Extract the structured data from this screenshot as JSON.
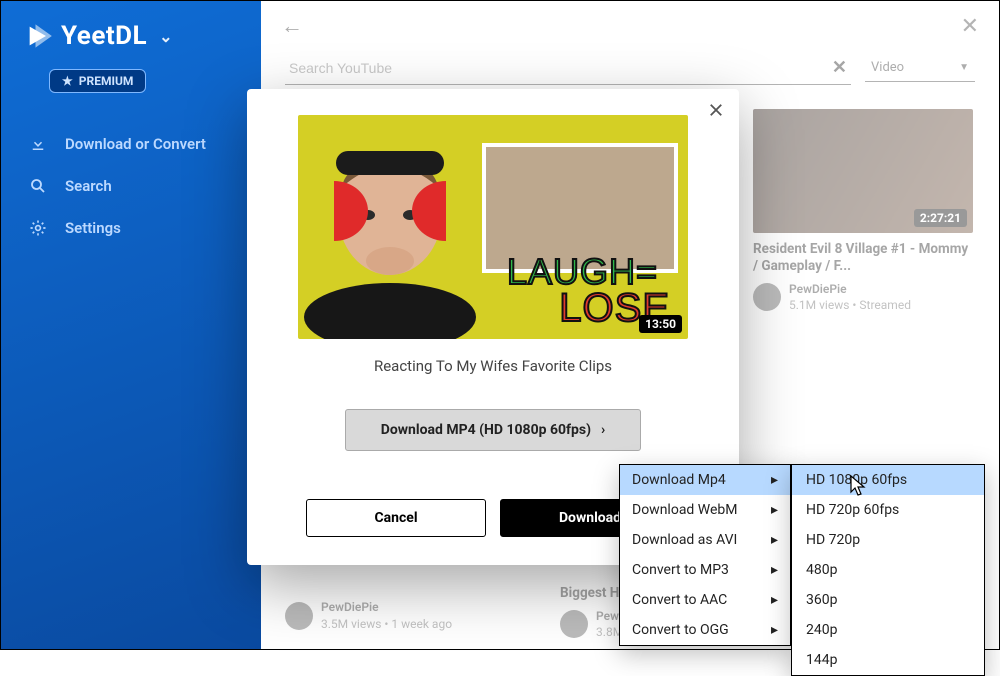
{
  "brand": {
    "name": "YeetDL",
    "premium_label": "PREMIUM"
  },
  "sidebar": {
    "items": [
      {
        "label": "Download or Convert"
      },
      {
        "label": "Search"
      },
      {
        "label": "Settings"
      }
    ]
  },
  "search": {
    "placeholder": "Search YouTube",
    "type_select": {
      "value": "Video"
    }
  },
  "results": [
    {
      "title": "Resident Evil 8 Village #1 - Mommy / Gameplay / F...",
      "duration": "2:27:21",
      "channel": "PewDiePie",
      "meta": "5.1M views • Streamed"
    },
    {
      "title": "Biggest House...",
      "channel": "PewDiePie",
      "meta": "3.8M views • 1 week ago"
    },
    {
      "title_alt_channel": "PewDiePie",
      "title_alt_meta": "3.5M views • 1 week ago"
    }
  ],
  "modal": {
    "thumb_text1": "LAUGH=",
    "thumb_text2": "LOSE",
    "thumb_dur": "13:50",
    "video_title": "Reacting To My Wifes Favorite Clips",
    "primary_button": "Download MP4 (HD 1080p 60fps)",
    "cancel": "Cancel",
    "download": "Download"
  },
  "format_menu": {
    "items": [
      "Download Mp4",
      "Download WebM",
      "Download as AVI",
      "Convert to MP3",
      "Convert to AAC",
      "Convert to OGG"
    ]
  },
  "quality_menu": {
    "items": [
      "HD 1080p 60fps",
      "HD 720p 60fps",
      "HD 720p",
      "480p",
      "360p",
      "240p",
      "144p"
    ],
    "selected_index": 0
  }
}
